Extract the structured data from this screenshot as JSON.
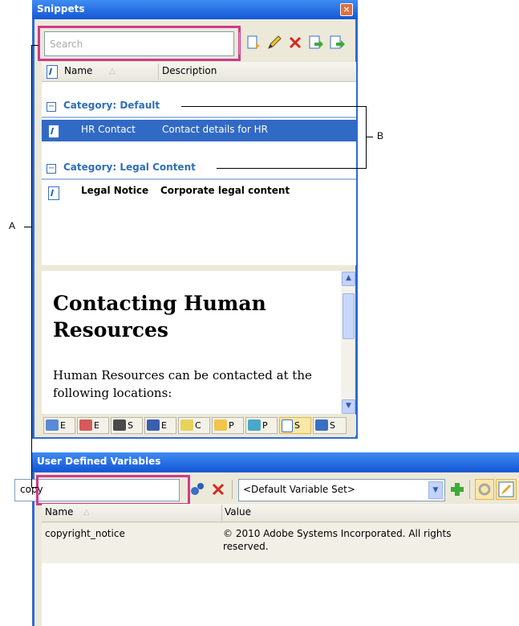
{
  "snippets_panel": {
    "title": "Snippets",
    "close_glyph": "×",
    "search_placeholder": "Search",
    "columns": {
      "name": "Name",
      "sort_glyph": "△",
      "description": "Description"
    },
    "categories": [
      {
        "toggle": "−",
        "label": "Category: Default",
        "items": [
          {
            "name": "HR Contact",
            "description": "Contact details for HR",
            "selected": true
          }
        ]
      },
      {
        "toggle": "−",
        "label": "Category: Legal Content",
        "items": [
          {
            "name": "Legal Notice",
            "description": "Corporate legal content",
            "selected": false
          }
        ]
      }
    ],
    "preview": {
      "heading": "Contacting Human Resources",
      "body": "Human Resources can be contacted at the following locations:"
    },
    "bottom_tabs": [
      {
        "label": "E",
        "icon": "table-icon"
      },
      {
        "label": "E",
        "icon": "list-icon"
      },
      {
        "label": "S",
        "icon": "binoculars-icon"
      },
      {
        "label": "E",
        "icon": "document-icon"
      },
      {
        "label": "C",
        "icon": "pencil-icon"
      },
      {
        "label": "P",
        "icon": "folder-icon"
      },
      {
        "label": "P",
        "icon": "project-icon"
      },
      {
        "label": "S",
        "icon": "snippet-icon",
        "selected": true
      },
      {
        "label": "S",
        "icon": "variables-icon"
      }
    ],
    "toolbar_icons": [
      "insert-snippet-icon",
      "edit-icon",
      "delete-icon",
      "import-icon",
      "export-icon"
    ]
  },
  "udv_panel": {
    "title": "User Defined Variables",
    "filter_value": "copy",
    "variable_set": "<Default Variable Set>",
    "columns": {
      "name": "Name",
      "sort_glyph": "△",
      "value": "Value"
    },
    "rows": [
      {
        "name": "copyright_notice",
        "value_line1": "© 2010 Adobe Systems Incorporated. All rights",
        "value_line2": "reserved."
      }
    ]
  },
  "callouts": {
    "a": "A",
    "b": "B"
  },
  "colors": {
    "titlebar": "#2f6ad5",
    "selection": "#316ac5",
    "category": "#2f6fb8",
    "highlight": "#d03a8c"
  }
}
